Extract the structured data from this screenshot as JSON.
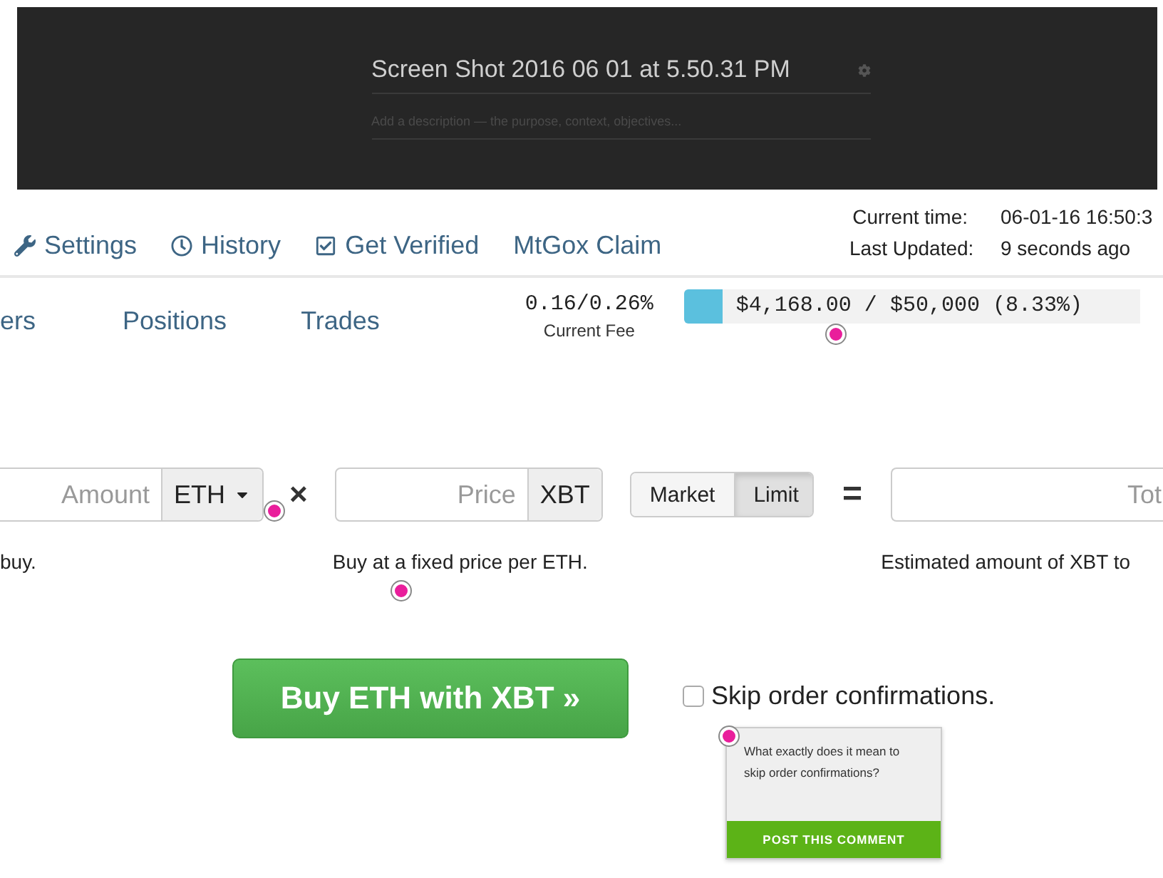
{
  "header": {
    "title": "Screen Shot 2016 06 01 at 5.50.31 PM",
    "description_placeholder": "Add a description — the purpose, context, objectives..."
  },
  "nav": [
    {
      "label": "Settings"
    },
    {
      "label": "History"
    },
    {
      "label": "Get Verified"
    },
    {
      "label": "MtGox Claim"
    }
  ],
  "status": [
    {
      "label": "Current time:",
      "value": "06-01-16 16:50:3"
    },
    {
      "label": "Last Updated:",
      "value": "9 seconds ago"
    }
  ],
  "tabs": [
    {
      "label": "ers"
    },
    {
      "label": "Positions"
    },
    {
      "label": "Trades"
    }
  ],
  "fee": {
    "value": "0.16/0.26%",
    "label": "Current Fee"
  },
  "volume": {
    "text": "$4,168.00 / $50,000 (8.33%)",
    "level": 0.0833
  },
  "form": {
    "amount_placeholder": "Amount",
    "amount_currency": "ETH",
    "multiply": "×",
    "price_placeholder": "Price",
    "price_currency": "XBT",
    "order_types": [
      {
        "label": "Market",
        "selected": false
      },
      {
        "label": "Limit",
        "selected": true
      }
    ],
    "equals": "=",
    "total_placeholder": "Tot",
    "hints": [
      "buy.",
      "Buy at a fixed price per ETH.",
      "Estimated amount of XBT to"
    ]
  },
  "buy_button": "Buy ETH with XBT »",
  "skip_confirmations": {
    "label": "Skip order confirmations.",
    "checked": false
  },
  "comment": {
    "text": "What exactly does it mean to skip order confirmations?",
    "button": "POST THIS COMMENT"
  }
}
